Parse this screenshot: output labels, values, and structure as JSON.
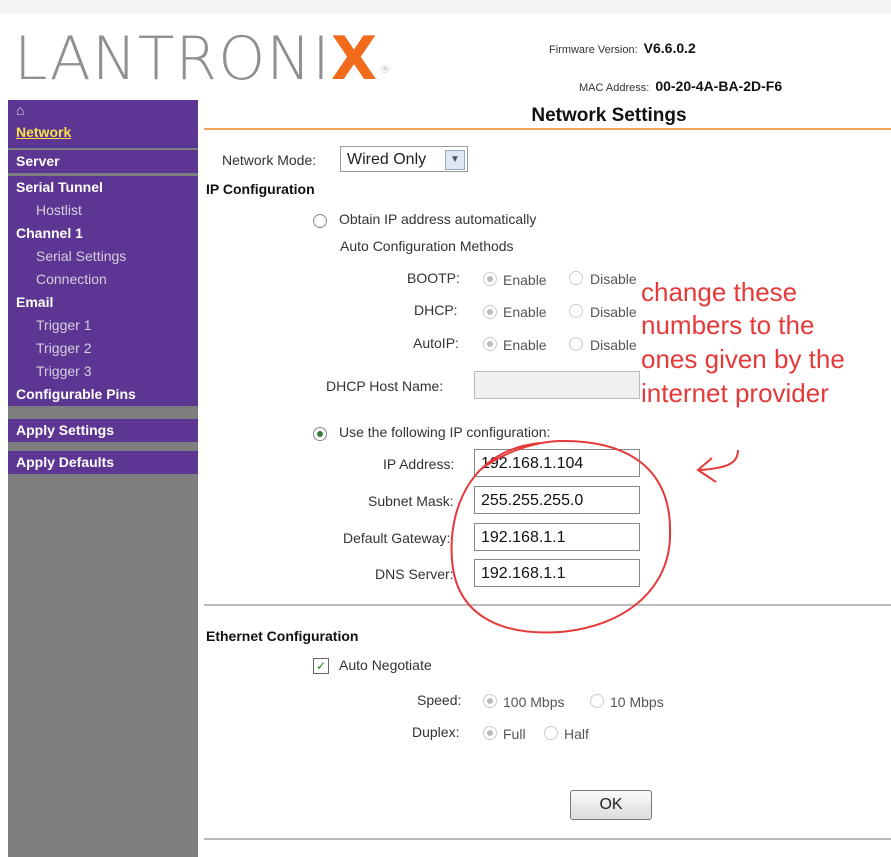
{
  "header": {
    "brand": "LANTRONIX",
    "firmware_label": "Firmware Version:",
    "firmware_value": "V6.6.0.2",
    "mac_label": "MAC Address:",
    "mac_value": "00-20-4A-BA-2D-F6",
    "page_title": "Network Settings"
  },
  "sidebar": {
    "items": [
      {
        "label": "Network"
      },
      {
        "label": "Server"
      },
      {
        "label": "Serial Tunnel"
      },
      {
        "label": "Hostlist"
      },
      {
        "label": "Channel 1"
      },
      {
        "label": "Serial Settings"
      },
      {
        "label": "Connection"
      },
      {
        "label": "Email"
      },
      {
        "label": "Trigger 1"
      },
      {
        "label": "Trigger 2"
      },
      {
        "label": "Trigger 3"
      },
      {
        "label": "Configurable Pins"
      },
      {
        "label": "Apply Settings"
      },
      {
        "label": "Apply Defaults"
      }
    ]
  },
  "network": {
    "mode_label": "Network Mode:",
    "mode_value": "Wired Only",
    "ip_config_heading": "IP Configuration",
    "obtain_auto_label": "Obtain IP address automatically",
    "auto_methods_label": "Auto Configuration Methods",
    "bootp_label": "BOOTP:",
    "dhcp_label": "DHCP:",
    "autoip_label": "AutoIP:",
    "enable_label": "Enable",
    "disable_label": "Disable",
    "dhcp_host_label": "DHCP Host Name:",
    "use_following_label": "Use the following IP configuration:",
    "ip_label": "IP Address:",
    "ip_value": "192.168.1.104",
    "subnet_label": "Subnet Mask:",
    "subnet_value": "255.255.255.0",
    "gateway_label": "Default Gateway:",
    "gateway_value": "192.168.1.1",
    "dns_label": "DNS Server:",
    "dns_value": "192.168.1.1"
  },
  "ethernet": {
    "heading": "Ethernet Configuration",
    "auto_negotiate_label": "Auto Negotiate",
    "speed_label": "Speed:",
    "speed_100": "100 Mbps",
    "speed_10": "10 Mbps",
    "duplex_label": "Duplex:",
    "duplex_full": "Full",
    "duplex_half": "Half",
    "ok_label": "OK"
  },
  "annotation": {
    "lines": [
      "change these",
      "numbers to the",
      "ones given by the",
      "internet provider"
    ],
    "color": "#e43a3a"
  }
}
